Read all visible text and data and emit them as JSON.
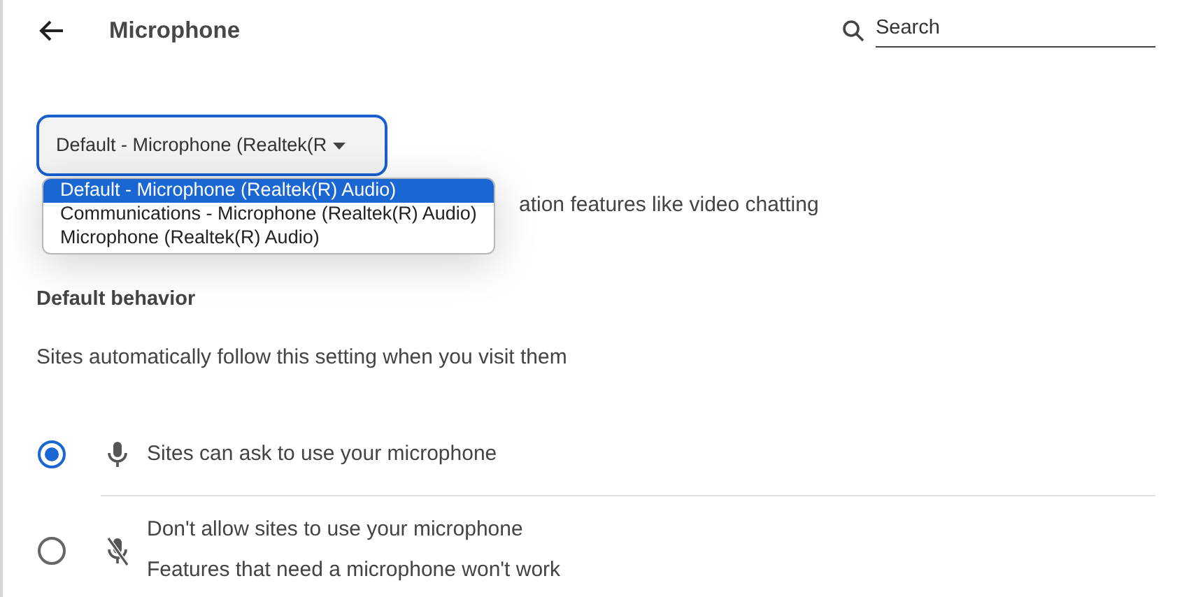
{
  "header": {
    "title": "Microphone",
    "search": {
      "placeholder": "Search"
    }
  },
  "device_select": {
    "value": "Default - Microphone (Realtek(R",
    "expanded": true,
    "options": [
      {
        "label": "Default - Microphone (Realtek(R) Audio)",
        "selected": true
      },
      {
        "label": "Communications - Microphone (Realtek(R) Audio)",
        "selected": false
      },
      {
        "label": "Microphone (Realtek(R) Audio)",
        "selected": false
      }
    ]
  },
  "description": "ation features like video chatting",
  "section": {
    "title": "Default behavior",
    "subtitle": "Sites automatically follow this setting when you visit them"
  },
  "behavior_options": [
    {
      "kind": "allow",
      "label": "Sites can ask to use your microphone",
      "selected": true
    },
    {
      "kind": "block",
      "label": "Don't allow sites to use your microphone",
      "sublabel": "Features that need a microphone won't work",
      "selected": false
    }
  ]
}
